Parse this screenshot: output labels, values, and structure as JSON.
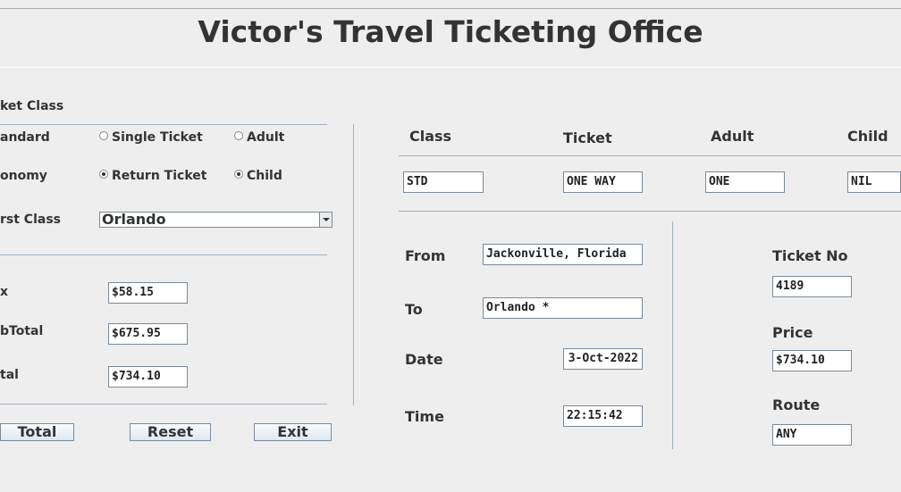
{
  "title": "Victor's Travel Ticketing Office",
  "ticket_class_panel": {
    "heading": "ket Class",
    "rows": [
      {
        "class_label": "andard",
        "ticket_option": "Single Ticket",
        "ticket_selected": false,
        "passenger_option": "Adult",
        "passenger_selected": false
      },
      {
        "class_label": "onomy",
        "ticket_option": "Return Ticket",
        "ticket_selected": true,
        "passenger_option": "Child",
        "passenger_selected": true
      }
    ],
    "first_class_label": "rst Class",
    "destination_selected": "Orlando"
  },
  "totals": {
    "tax_label": "x",
    "tax_value": "$58.15",
    "subtotal_label": "bTotal",
    "subtotal_value": "$675.95",
    "total_label": "tal",
    "total_value": "$734.10"
  },
  "buttons": {
    "total": "Total",
    "reset": "Reset",
    "exit": "Exit"
  },
  "summary": {
    "headers": {
      "class": "Class",
      "ticket": "Ticket",
      "adult": "Adult",
      "child": "Child"
    },
    "values": {
      "class": "STD",
      "ticket": "ONE WAY",
      "adult": "ONE",
      "child": "NIL"
    }
  },
  "journey": {
    "from_label": "From",
    "from_value": "Jackonville, Florida",
    "to_label": "To",
    "to_value": "Orlando *",
    "date_label": "Date",
    "date_value": "3-Oct-2022",
    "time_label": "Time",
    "time_value": "22:15:42"
  },
  "ticket_info": {
    "ticket_no_label": "Ticket No",
    "ticket_no_value": "4189",
    "price_label": "Price",
    "price_value": "$734.10",
    "route_label": "Route",
    "route_value": "ANY"
  }
}
